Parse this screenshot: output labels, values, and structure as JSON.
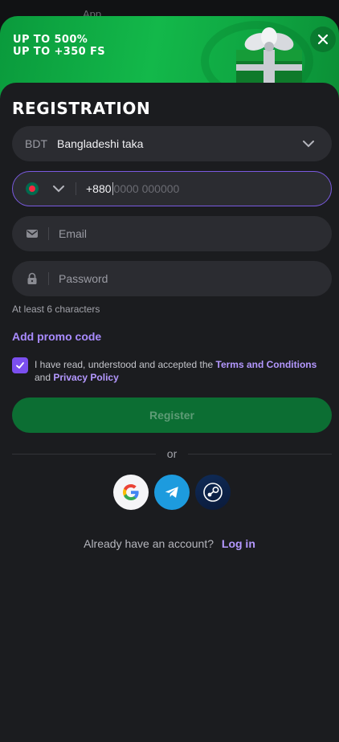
{
  "topbar": {
    "app_label": "App"
  },
  "banner": {
    "line1": "UP TO 500%",
    "line2": "UP TO +350 FS",
    "gift_icon": "gift-box-icon",
    "close_icon": "close-icon"
  },
  "form": {
    "title": "REGISTRATION",
    "currency": {
      "code": "BDT",
      "name": "Bangladeshi taka"
    },
    "phone": {
      "country": "Bangladesh",
      "prefix": "+880",
      "placeholder": "0000 000000"
    },
    "email": {
      "placeholder": "Email"
    },
    "password": {
      "placeholder": "Password",
      "hint": "At least 6 characters"
    },
    "promo_link": "Add promo code",
    "consent": {
      "checked": true,
      "text_before": "I have read, understood and accepted the ",
      "terms_link": "Terms and Conditions",
      "text_and": " and ",
      "privacy_link": "Privacy Policy"
    },
    "register_button": "Register",
    "separator": "or",
    "social": [
      "google",
      "telegram",
      "steam"
    ],
    "login_prompt": "Already have an account?",
    "login_link": "Log in"
  },
  "colors": {
    "accent_purple": "#7b4fef",
    "banner_green": "#13b84a",
    "register_green": "#0c6e33",
    "background": "#1b1c1f"
  }
}
